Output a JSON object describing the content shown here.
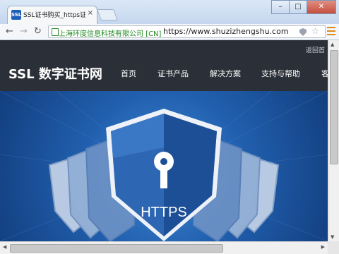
{
  "browser": {
    "tab": {
      "title": "SSL证书购买_https证书在",
      "close": "×",
      "favicon": "SSL"
    },
    "window_controls": {
      "minimize": "–",
      "maximize": "□",
      "close": "✕"
    },
    "nav": {
      "back": "←",
      "forward": "→",
      "reload": "↻"
    },
    "address": {
      "org": "上海环度信息科技有限公司 [CN]",
      "url": "https://www.shuzizhengshu.com"
    }
  },
  "site": {
    "back_home": "返回首",
    "logo": "SSL 数字证书网",
    "nav": [
      "首页",
      "证书产品",
      "解决方案",
      "支持与帮助",
      "客"
    ],
    "hero_badge": "HTTPS"
  },
  "scrollbars": {
    "up": "▲",
    "down": "▼",
    "left": "◀",
    "right": "▶"
  },
  "colors": {
    "accent_menu": "#e08a1c",
    "secure_green": "#1f8a1f",
    "site_header": "#2b2f37"
  }
}
